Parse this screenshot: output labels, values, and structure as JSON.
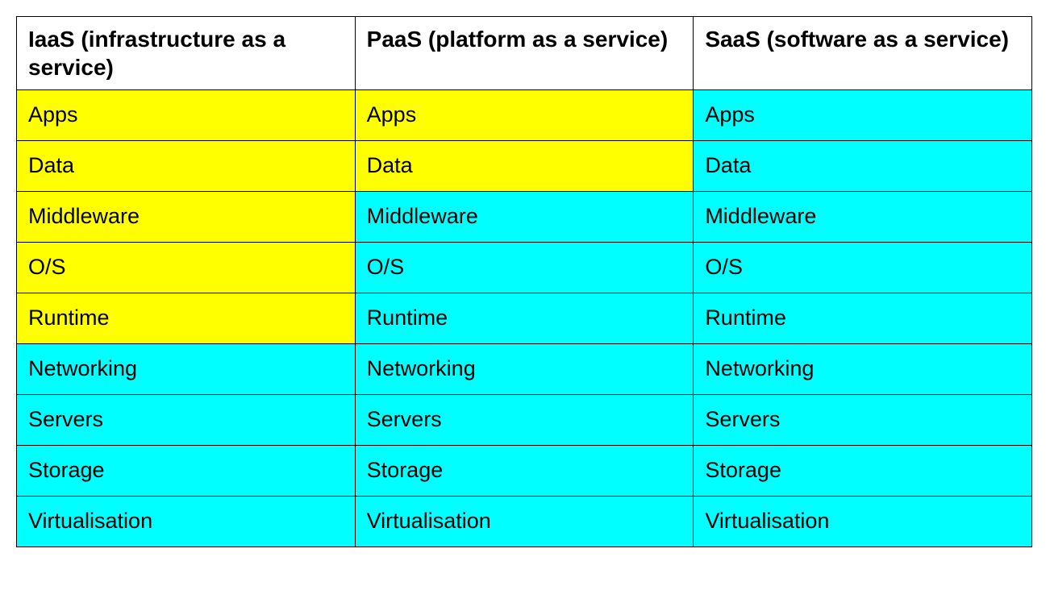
{
  "colors": {
    "user_managed": "#ffff00",
    "provider_managed": "#00ffff"
  },
  "table": {
    "columns": [
      {
        "key": "iaas",
        "header": "IaaS (infrastructure as a service)"
      },
      {
        "key": "paas",
        "header": "PaaS (platform as a service)"
      },
      {
        "key": "saas",
        "header": "SaaS (software as a service)"
      }
    ],
    "layers": [
      "Apps",
      "Data",
      "Middleware",
      "O/S",
      "Runtime",
      "Networking",
      "Servers",
      "Storage",
      "Virtualisation"
    ],
    "ownership": {
      "iaas": [
        "user",
        "user",
        "user",
        "user",
        "user",
        "provider",
        "provider",
        "provider",
        "provider"
      ],
      "paas": [
        "user",
        "user",
        "provider",
        "provider",
        "provider",
        "provider",
        "provider",
        "provider",
        "provider"
      ],
      "saas": [
        "provider",
        "provider",
        "provider",
        "provider",
        "provider",
        "provider",
        "provider",
        "provider",
        "provider"
      ]
    }
  }
}
